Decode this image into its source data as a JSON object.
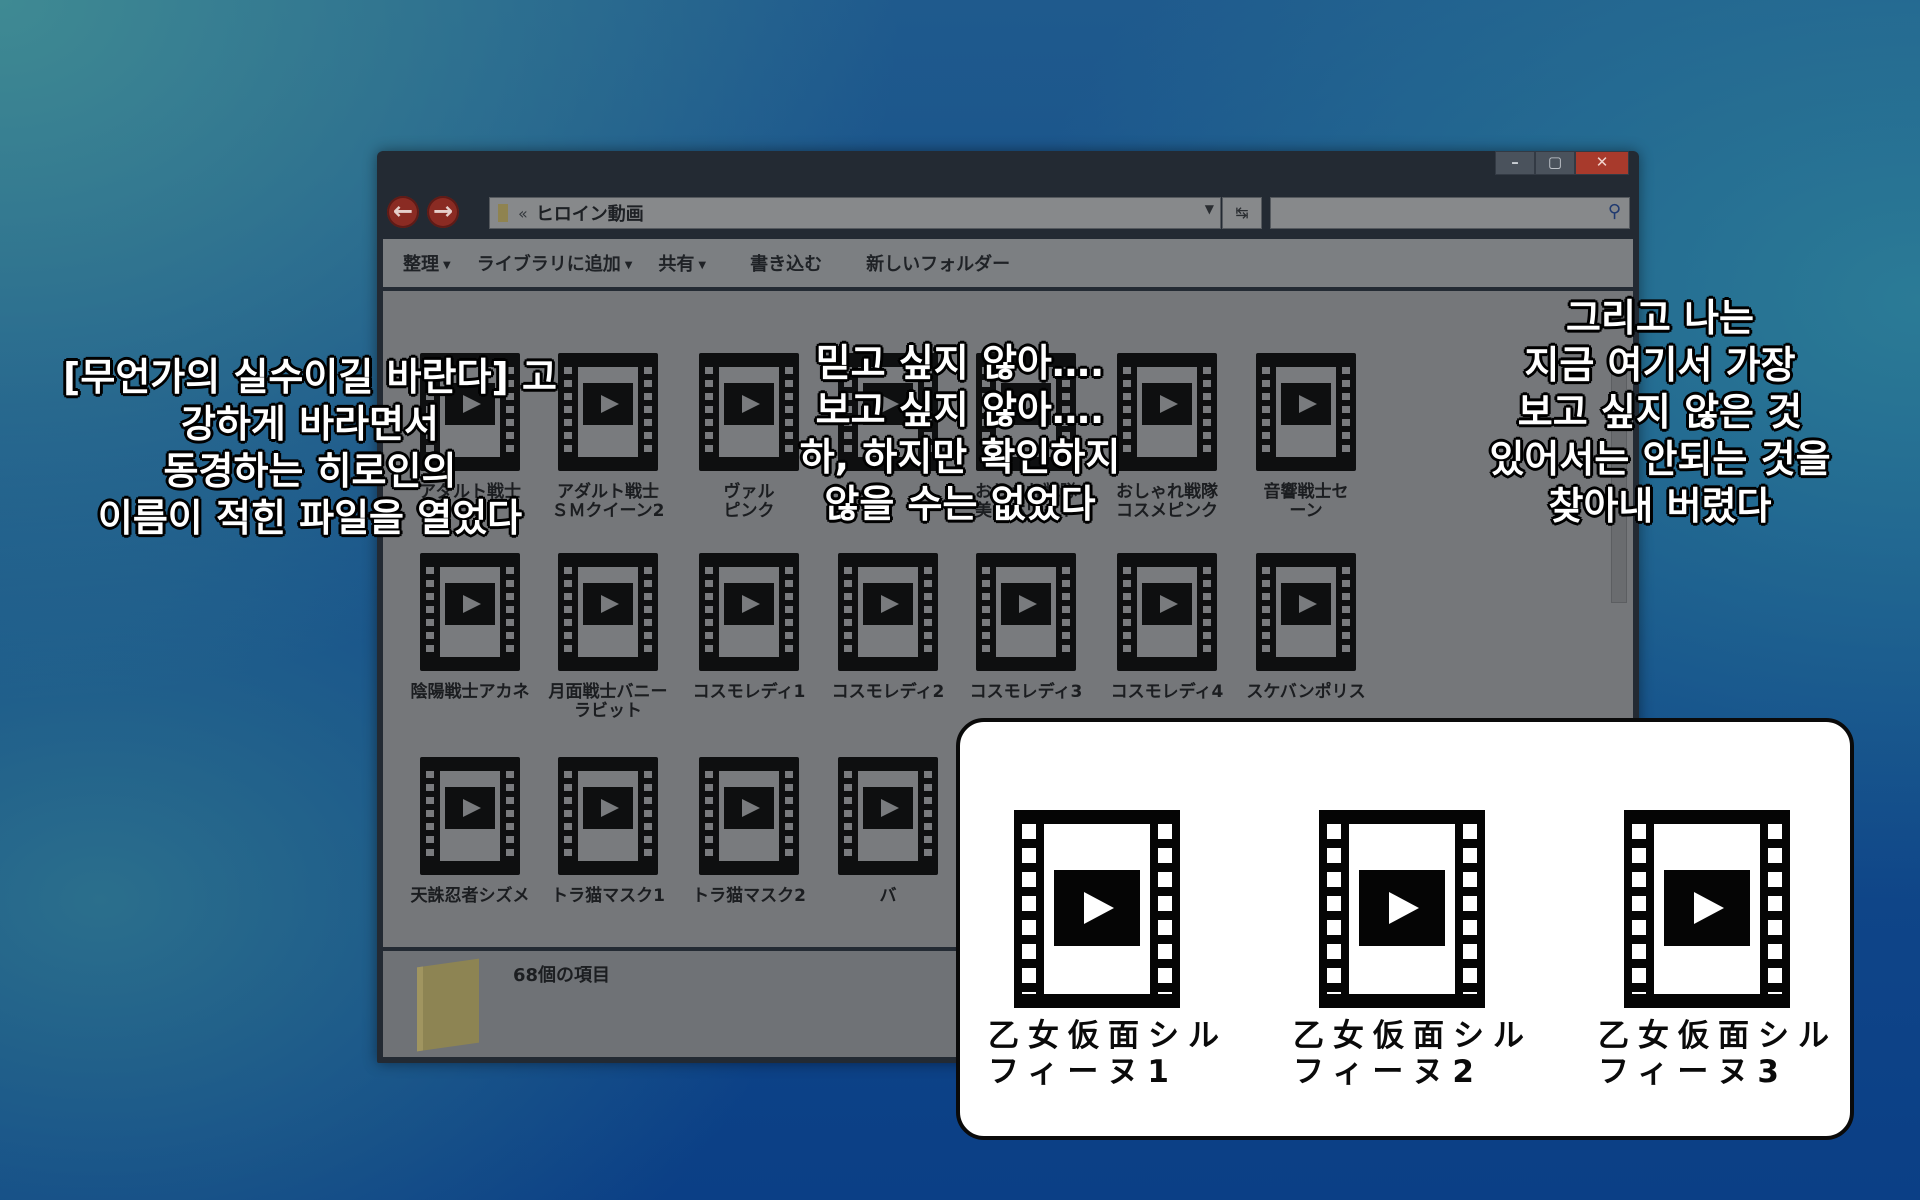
{
  "window": {
    "controls": {
      "minimize": "–",
      "maximize": "▢",
      "close": "✕"
    },
    "nav": {
      "back": "←",
      "forward": "→"
    },
    "address": {
      "separator": "«",
      "path": "ヒロイン動画"
    },
    "toolbar": {
      "organize": "整理",
      "add_to_library": "ライブラリに追加",
      "share": "共有",
      "burn": "書き込む",
      "new_folder": "新しいフォルダー"
    },
    "files_row1": [
      "アダルト戦士\nン1",
      "アダルト戦士\nＳＭクイーン2",
      "ヴァル\nピンク",
      "",
      "おしゃれ戦隊\n美白ホワイト",
      "おしゃれ戦隊\nコスメピンク",
      "音響戦士セ\nーン"
    ],
    "files_row2": [
      "陰陽戦士アカネ",
      "月面戦士バニー\nラビット",
      "コスモレディ1",
      "コスモレディ2",
      "コスモレディ3",
      "コスモレディ4",
      "スケバンポリス"
    ],
    "files_row3": [
      "天誅忍者シズメ",
      "トラ猫マスク1",
      "トラ猫マスク2",
      "バ"
    ],
    "status": {
      "item_count": "68個の項目"
    }
  },
  "zoom_panel": {
    "files": [
      "乙女仮面シル\nフィーヌ1",
      "乙女仮面シル\nフィーヌ2",
      "乙女仮面シル\nフィーヌ3"
    ]
  },
  "subtitles": {
    "left": "[무언가의 실수이길 바란다] 고\n강하게 바라면서\n동경하는 히로인의\n이름이 적힌 파일을 열었다",
    "center": "믿고 싶지 않아….\n보고 싶지 않아….\n하, 하지만 확인하지\n않을 수는 없었다",
    "right": "그리고 나는\n지금 여기서 가장\n보고 싶지 않은 것\n있어서는 안되는 것을\n찾아내 버렸다"
  }
}
